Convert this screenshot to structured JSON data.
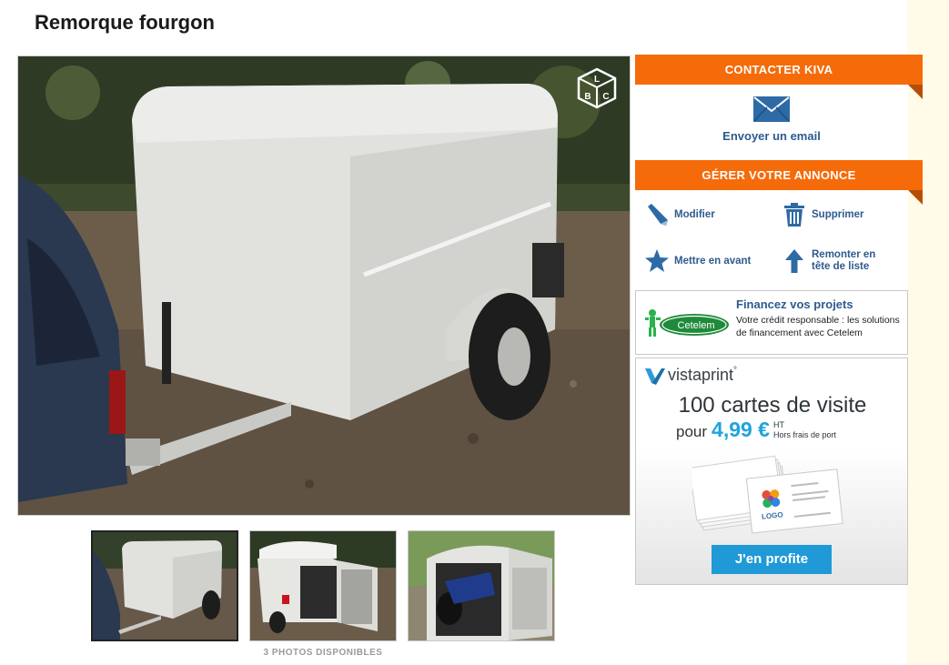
{
  "listing": {
    "title": "Remorque fourgon"
  },
  "photos": {
    "count_label": "3 PHOTOS DISPONIBLES"
  },
  "contact": {
    "header": "CONTACTER KIVA",
    "email_label": "Envoyer un email"
  },
  "manage": {
    "header": "GÉRER VOTRE ANNONCE",
    "actions": [
      {
        "label": "Modifier",
        "icon": "pencil-icon"
      },
      {
        "label": "Supprimer",
        "icon": "trash-icon"
      },
      {
        "label": "Mettre en avant",
        "icon": "star-icon"
      },
      {
        "label": "Remonter en tête de liste",
        "icon": "arrow-up-icon"
      }
    ]
  },
  "ads": {
    "cetelem": {
      "logo_text": "Cetelem",
      "title": "Financez vos projets",
      "text": "Votre crédit responsable : les solutions de financement avec Cetelem"
    },
    "vistaprint": {
      "brand": "vistaprint",
      "brand_mark": "°",
      "headline": "100 cartes de visite",
      "pour": "pour",
      "price": "4,99 €",
      "ht": "HT",
      "shipping": "Hors frais de port",
      "cta": "J'en profite",
      "card_logo": "LOGO"
    }
  },
  "badge": {
    "letters": [
      "L",
      "B",
      "C"
    ]
  },
  "colors": {
    "accent_orange": "#f56b0a",
    "link_blue": "#2e5b8e",
    "vista_blue": "#1fa3dc"
  }
}
